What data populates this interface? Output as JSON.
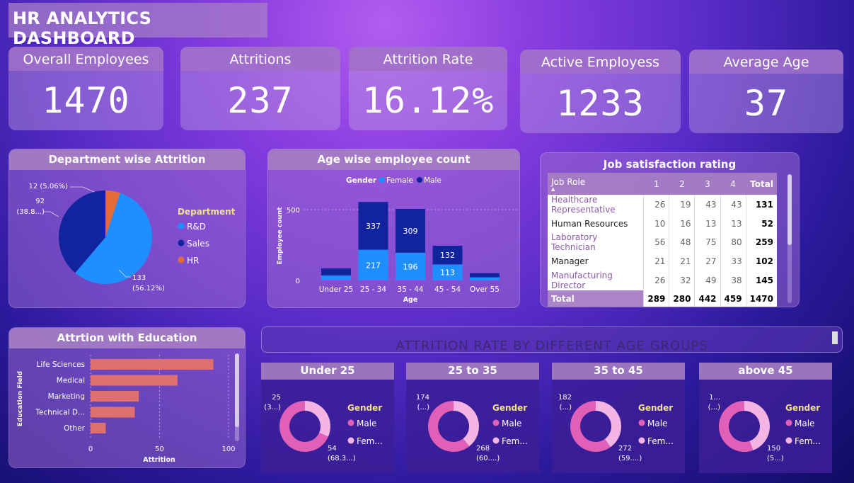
{
  "title": "HR ANALYTICS DASHBOARD",
  "kpis": [
    {
      "label": "Overall Employees",
      "value": "1470"
    },
    {
      "label": "Attritions",
      "value": "237"
    },
    {
      "label": "Attrition Rate",
      "value": "16.12%"
    },
    {
      "label": "Active Employess",
      "value": "1233"
    },
    {
      "label": "Average Age",
      "value": "37"
    }
  ],
  "dept": {
    "title": "Department wise Attrition",
    "legend_title": "Department",
    "legend": [
      "R&D",
      "Sales",
      "HR"
    ],
    "labels": {
      "hr": "12 (5.06%)",
      "sales_a": "92",
      "sales_b": "(38.8...)",
      "rd_a": "133",
      "rd_b": "(56.12%)"
    }
  },
  "age": {
    "title": "Age wise employee count",
    "legend_title": "Gender",
    "legend": [
      "Female",
      "Male"
    ],
    "ylabel": "Employee count",
    "xlabel": "Age",
    "ticks": [
      "500",
      "0"
    ]
  },
  "job": {
    "title": "Job satisfaction rating",
    "headers": [
      "Job Role",
      "1",
      "2",
      "3",
      "4",
      "Total"
    ],
    "rows": [
      [
        "Healthcare Representative",
        "26",
        "19",
        "43",
        "43",
        "131"
      ],
      [
        "Human Resources",
        "10",
        "16",
        "13",
        "13",
        "52"
      ],
      [
        "Laboratory Technician",
        "56",
        "48",
        "75",
        "80",
        "259"
      ],
      [
        "Manager",
        "21",
        "21",
        "27",
        "33",
        "102"
      ],
      [
        "Manufacturing Director",
        "26",
        "32",
        "49",
        "38",
        "145"
      ]
    ],
    "total": [
      "Total",
      "289",
      "280",
      "442",
      "459",
      "1470"
    ]
  },
  "edu": {
    "title": "Attrtion with Education",
    "ylabel": "Education Field",
    "xlabel": "Attrition",
    "ticks": [
      "0",
      "50",
      "100"
    ]
  },
  "agegroups": {
    "title": "ATTRITION RATE BY DIFFERENT AGE GROUPS",
    "legend_title": "Gender",
    "legend": [
      "Male",
      "Fem..."
    ],
    "items": [
      {
        "title": "Under 25",
        "top_a": "25",
        "top_b": "(3...)",
        "bot_a": "54",
        "bot_b": "(68.3...)"
      },
      {
        "title": "25 to 35",
        "top_a": "174",
        "top_b": "(...)",
        "bot_a": "268",
        "bot_b": "(60....)"
      },
      {
        "title": "35 to 45",
        "top_a": "182",
        "top_b": "(...)",
        "bot_a": "272",
        "bot_b": "(59....)"
      },
      {
        "title": "above 45",
        "top_a": "1...",
        "top_b": "(...)",
        "bot_a": "150",
        "bot_b": "(5...)"
      }
    ]
  },
  "colors": {
    "rd": "#1f8fff",
    "sales": "#12239e",
    "hr": "#e66c37",
    "female": "#1f8fff",
    "male": "#12239e",
    "edu_bar": "#e07070",
    "donut_male": "#e060b8",
    "donut_female": "#f4b4e4"
  },
  "chart_data": [
    {
      "type": "pie",
      "title": "Department wise Attrition",
      "categories": [
        "R&D",
        "Sales",
        "HR"
      ],
      "values": [
        133,
        92,
        12
      ],
      "percent": [
        56.12,
        38.8,
        5.06
      ]
    },
    {
      "type": "bar",
      "stacked": true,
      "title": "Age wise employee count",
      "categories": [
        "Under 25",
        "25 - 34",
        "35 - 44",
        "45 - 54",
        "Over 55"
      ],
      "series": [
        {
          "name": "Female",
          "values": [
            35,
            217,
            196,
            113,
            22
          ]
        },
        {
          "name": "Male",
          "values": [
            50,
            337,
            309,
            132,
            30
          ]
        }
      ],
      "xlabel": "Age",
      "ylabel": "Employee count",
      "ylim": [
        0,
        650
      ]
    },
    {
      "type": "bar",
      "orientation": "horizontal",
      "title": "Attrtion with Education",
      "categories": [
        "Life Sciences",
        "Medical",
        "Marketing",
        "Technical D...",
        "Other"
      ],
      "values": [
        89,
        63,
        35,
        32,
        11
      ],
      "xlabel": "Attrition",
      "ylabel": "Education Field",
      "xlim": [
        0,
        100
      ]
    },
    {
      "type": "pie",
      "title": "Under 25",
      "categories": [
        "Male",
        "Female"
      ],
      "values": [
        54,
        25
      ]
    },
    {
      "type": "pie",
      "title": "25 to 35",
      "categories": [
        "Male",
        "Female"
      ],
      "values": [
        268,
        174
      ]
    },
    {
      "type": "pie",
      "title": "35 to 45",
      "categories": [
        "Male",
        "Female"
      ],
      "values": [
        272,
        182
      ]
    },
    {
      "type": "pie",
      "title": "above 45",
      "categories": [
        "Male",
        "Female"
      ],
      "values": [
        150,
        120
      ]
    }
  ]
}
